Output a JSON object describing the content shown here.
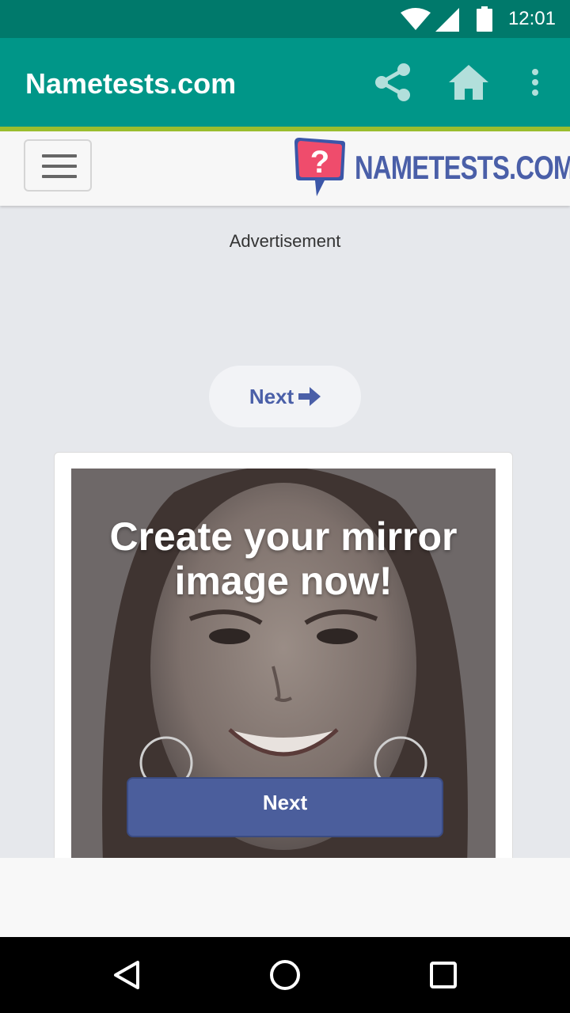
{
  "status_bar": {
    "time": "12:01",
    "icons": [
      "wifi-icon",
      "cell-signal-icon",
      "battery-icon"
    ]
  },
  "app_bar": {
    "title": "Nametests.com",
    "actions": [
      "share-icon",
      "home-icon",
      "more-vert-icon"
    ],
    "colors": {
      "background": "#009688",
      "status": "#00796b",
      "accent_line": "#9bbe2e"
    }
  },
  "site_header": {
    "logo_text": "NAMETESTS.COM",
    "menu_icon": "hamburger-icon",
    "brand_color": "#4a5fa8"
  },
  "main": {
    "ad_label": "Advertisement",
    "next_pill_label": "Next",
    "next_pill_icon": "arrow-right-icon",
    "quiz": {
      "heading": "Create your mirror image now!",
      "next_label": "Next",
      "button_color": "#4b5e9c"
    }
  },
  "nav_bar": {
    "buttons": [
      "back-icon",
      "home-circle-icon",
      "recents-icon"
    ]
  }
}
